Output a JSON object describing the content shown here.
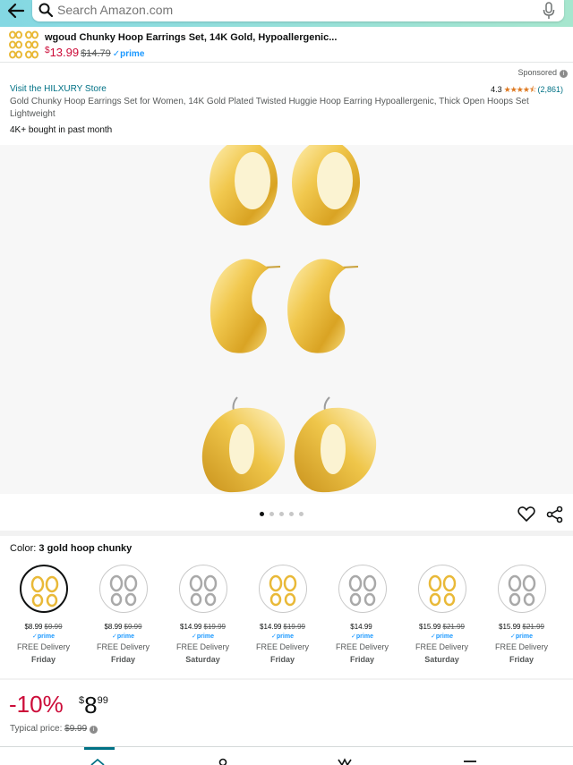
{
  "header": {
    "back_icon": "arrow-left-icon",
    "search_placeholder": "Search Amazon.com",
    "search_icon": "search-icon",
    "mic_icon": "microphone-icon",
    "gradient_colors": [
      "#84d8e3",
      "#a6e6ce"
    ]
  },
  "sticky_strip": {
    "title": "wgoud Chunky Hoop Earrings Set, 14K Gold, Hypoallergenic...",
    "price_symbol": "$",
    "price": "13.99",
    "old_price": "$14.79",
    "prime_label": "prime"
  },
  "listing": {
    "sponsored": "Sponsored",
    "info_glyph": "i",
    "store_link": "Visit the HILXURY Store",
    "rating_value": "4.3",
    "stars": "★★★★⯪",
    "rating_count": "(2,861)",
    "description": "Gold Chunky Hoop Earrings Set for Women, 14K Gold Plated Twisted Huggie Hoop Earring Hypoallergenic, Thick Open Hoops Set Lightweight",
    "bought": "4K+ bought in past month"
  },
  "gallery": {
    "active_index": 0,
    "dot_count": 5,
    "heart_icon": "heart-icon",
    "share_icon": "share-icon"
  },
  "color": {
    "label": "Color:",
    "selected": "3 gold hoop chunky",
    "options": [
      {
        "price": "$8.99",
        "old": "$9.99",
        "prime": "✓prime",
        "delivery": "FREE Delivery",
        "day": "Friday",
        "tone": "gold"
      },
      {
        "price": "$8.99",
        "old": "$9.99",
        "prime": "✓prime",
        "delivery": "FREE Delivery",
        "day": "Friday",
        "tone": "silver"
      },
      {
        "price": "$14.99",
        "old": "$19.99",
        "prime": "✓prime",
        "delivery": "FREE Delivery",
        "day": "Saturday",
        "tone": "silver"
      },
      {
        "price": "$14.99",
        "old": "$19.99",
        "prime": "✓prime",
        "delivery": "FREE Delivery",
        "day": "Friday",
        "tone": "gold"
      },
      {
        "price": "$14.99",
        "old": "",
        "prime": "✓prime",
        "delivery": "FREE Delivery",
        "day": "Friday",
        "tone": "silver"
      },
      {
        "price": "$15.99",
        "old": "$21.99",
        "prime": "✓prime",
        "delivery": "FREE Delivery",
        "day": "Saturday",
        "tone": "gold"
      },
      {
        "price": "$15.99",
        "old": "$21.99",
        "prime": "✓prime",
        "delivery": "FREE Delivery",
        "day": "Friday",
        "tone": "silver"
      }
    ]
  },
  "pricing": {
    "discount": "-10%",
    "symbol": "$",
    "whole": "8",
    "cents": "99",
    "typical_label": "Typical price:",
    "typical_value": "$9.99"
  },
  "colors": {
    "deal_red": "#cc0c39",
    "link_teal": "#007185",
    "prime_blue": "#1a98ff",
    "star_orange": "#de7921",
    "gold": "#e9b938"
  }
}
